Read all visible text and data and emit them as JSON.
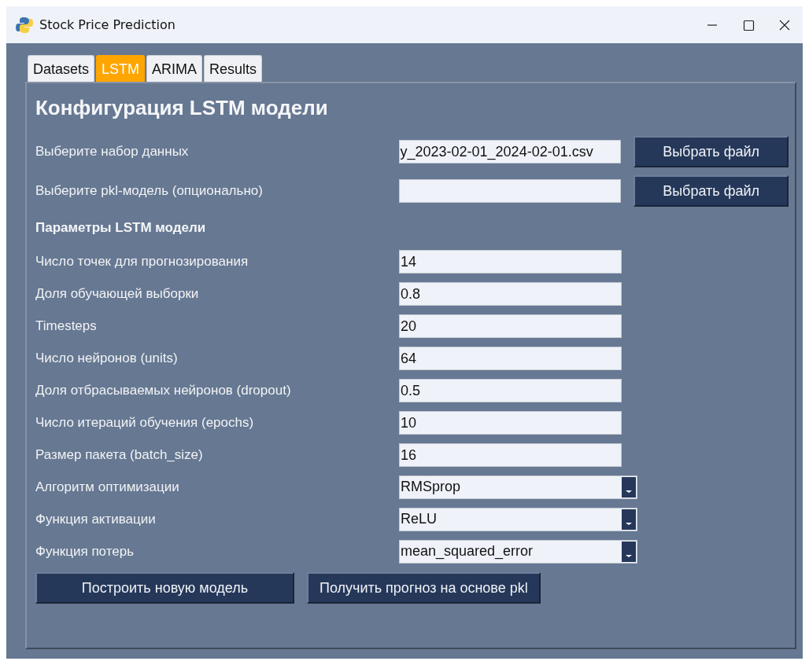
{
  "window": {
    "title": "Stock Price Prediction"
  },
  "tabs": [
    {
      "label": "Datasets",
      "selected": false
    },
    {
      "label": "LSTM",
      "selected": true
    },
    {
      "label": "ARIMA",
      "selected": false
    },
    {
      "label": "Results",
      "selected": false
    }
  ],
  "heading": "Конфигурация LSTM модели",
  "file_rows": [
    {
      "label": "Выберите набор данных",
      "value": "y_2023-02-01_2024-02-01.csv",
      "button": "Выбрать файл"
    },
    {
      "label": "Выберите pkl-модель (опционально)",
      "button": "Выбрать файл"
    }
  ],
  "section_title": "Параметры LSTM модели",
  "params": [
    {
      "kind": "entry",
      "label": "Число точек для прогнозирования",
      "value": "14"
    },
    {
      "kind": "entry",
      "label": "Доля обучающей выборки",
      "value": "0.8"
    },
    {
      "kind": "entry",
      "label": "Timesteps",
      "value": "20"
    },
    {
      "kind": "entry",
      "label": "Число нейронов (units)",
      "value": "64"
    },
    {
      "kind": "entry",
      "label": "Доля отбрасываемых нейронов (dropout)",
      "value": "0.5"
    },
    {
      "kind": "entry",
      "label": "Число итераций обучения (epochs)",
      "value": "10"
    },
    {
      "kind": "entry",
      "label": "Размер пакета (batch_size)",
      "value": "16"
    },
    {
      "kind": "select",
      "label": "Алгоритм оптимизации",
      "value": "RMSprop"
    },
    {
      "kind": "select",
      "label": "Функция активации",
      "value": "ReLU"
    },
    {
      "kind": "select",
      "label": "Функция потерь",
      "value": "mean_squared_error"
    }
  ],
  "actions": [
    "Построить новую модель",
    "Получить прогноз на основе pkl"
  ]
}
